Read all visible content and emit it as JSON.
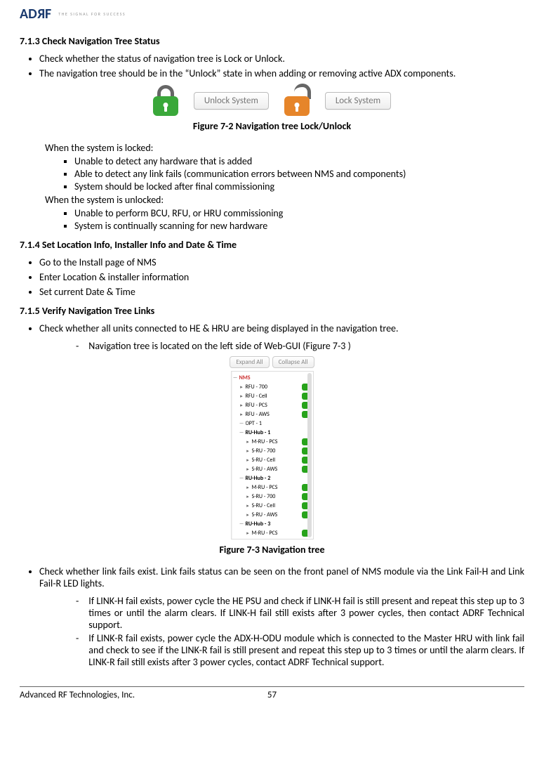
{
  "logo": {
    "brand_letters": [
      "A",
      "D",
      "R",
      "F"
    ],
    "tagline": "THE SIGNAL FOR SUCCESS"
  },
  "s713": {
    "heading": "7.1.3     Check Navigation Tree Status",
    "bullets": [
      "Check whether the status of navigation tree is Lock or Unlock.",
      "The navigation tree should be in the “Unlock” state in when adding or removing  active ADX components."
    ],
    "unlock_btn": "Unlock System",
    "lock_btn": "Lock System",
    "fig_caption": "Figure 7-2     Navigation tree Lock/Unlock",
    "locked_intro": "When the system is locked:",
    "locked_items": [
      "Unable to detect any hardware that is added",
      "Able to detect any link fails (communication errors between NMS and components)",
      "System should be locked after final commissioning"
    ],
    "unlocked_intro": "When the system is unlocked:",
    "unlocked_items": [
      "Unable to perform BCU, RFU, or HRU commissioning",
      "System is continually scanning for new hardware"
    ]
  },
  "s714": {
    "heading": "7.1.4     Set Location Info, Installer Info and Date & Time",
    "bullets": [
      "Go to the Install page of NMS",
      "Enter Location & installer information",
      "Set current Date & Time"
    ]
  },
  "s715": {
    "heading": "7.1.5     Verify Navigation Tree Links",
    "bullet1": "Check whether all units connected to HE & HRU are being displayed in the navigation tree.",
    "sub1": "Navigation tree is located on the left side of Web-GUI (Figure 7-3 )",
    "expand": "Expand All",
    "collapse": "Collapse All",
    "tree_root": "NMS",
    "tree": [
      {
        "lvl": 1,
        "tog": "▸",
        "label": "RFU - 700"
      },
      {
        "lvl": 1,
        "tog": "▸",
        "label": "RFU - Cell"
      },
      {
        "lvl": 1,
        "tog": "▸",
        "label": "RFU - PCS"
      },
      {
        "lvl": 1,
        "tog": "▸",
        "label": "RFU - AWS"
      },
      {
        "lvl": 1,
        "tog": "—",
        "label": "OPT - 1",
        "nodot": true
      },
      {
        "lvl": 1,
        "tog": "—",
        "label": "RU-Hub - 1",
        "bold": true,
        "nodot": true
      },
      {
        "lvl": 2,
        "tog": "▸",
        "label": "M-RU - PCS"
      },
      {
        "lvl": 2,
        "tog": "▸",
        "label": "S-RU - 700"
      },
      {
        "lvl": 2,
        "tog": "▸",
        "label": "S-RU - Cell"
      },
      {
        "lvl": 2,
        "tog": "▸",
        "label": "S-RU - AWS"
      },
      {
        "lvl": 1,
        "tog": "—",
        "label": "RU-Hub - 2",
        "bold": true,
        "nodot": true
      },
      {
        "lvl": 2,
        "tog": "▸",
        "label": "M-RU - PCS"
      },
      {
        "lvl": 2,
        "tog": "▸",
        "label": "S-RU - 700"
      },
      {
        "lvl": 2,
        "tog": "▸",
        "label": "S-RU - Cell"
      },
      {
        "lvl": 2,
        "tog": "▸",
        "label": "S-RU - AWS"
      },
      {
        "lvl": 1,
        "tog": "—",
        "label": "RU-Hub - 3",
        "bold": true,
        "nodot": true
      },
      {
        "lvl": 2,
        "tog": "▸",
        "label": "M-RU - PCS"
      }
    ],
    "fig_caption": "Figure 7-3     Navigation tree",
    "bullet2": "Check whether link fails exist.  Link fails status can be seen on the front panel of NMS module via the Link Fail-H and Link Fail-R LED lights.",
    "sub2a": "If LINK-H fail exists, power cycle the HE PSU and check if LINK-H fail is still present and repeat this step up to 3 times or until the alarm clears.  If LINK-H fail still exists after 3 power cycles, then contact ADRF Technical support.",
    "sub2b": "If LINK-R fail exists, power cycle the ADX-H-ODU module which is connected to the Master HRU with link fail and check to see if the LINK-R fail is still present and repeat this step up to 3 times or until the alarm clears. If LINK-R fail still exists after 3 power cycles, contact ADRF Technical support."
  },
  "footer": {
    "company": "Advanced RF Technologies, Inc.",
    "page": "57"
  }
}
